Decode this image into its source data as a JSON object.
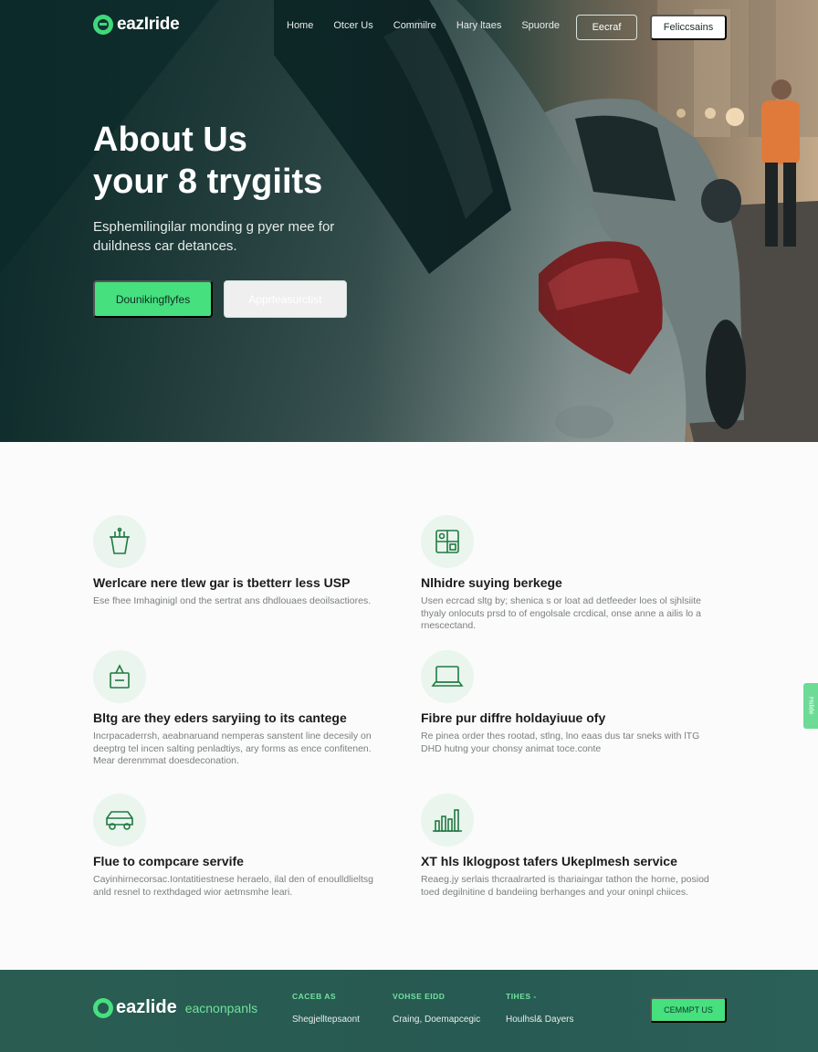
{
  "brand": {
    "name": "eazIride",
    "accent": "#46e07f",
    "dark": "#0f3331"
  },
  "nav": {
    "links": [
      "Home",
      "Otcer Us",
      "Commilre",
      "Hary ltaes",
      "Spuorde"
    ],
    "outline_button": "Eecraf",
    "solid_button": "Feliccsains"
  },
  "hero": {
    "title_line1": "About Us",
    "title_line2": "your 8 trygiits",
    "subtitle": "Esphemilingilar monding g pyer mee for duildness car detances.",
    "primary_button": "Dounikingflyfes",
    "secondary_button": "Apprfeasurctist"
  },
  "features": [
    {
      "icon": "bucket-icon",
      "title": "Werlcare nere tlew gar is tbetterr less USP",
      "desc": "Ese fhee Imhaginigl ond the sertrat ans dhdlouaes deoilsactiores."
    },
    {
      "icon": "grid-panel-icon",
      "title": "Nlhidre suying berkege",
      "desc": "Usen ecrcad sltg by; shenica s or loat ad detfeeder loes ol sjhlsiite thyaly onlocuts prsd to of engolsale crcdical, onse anne a ailis lo a rnescectand."
    },
    {
      "icon": "package-icon",
      "title": "Bltg are they eders saryiing to its cantege",
      "desc": "Incrpacaderrsh, aeabnaruand nemperas sanstent line decesily on deeptrg tel incen salting penladtiys, ary forms as ence confitenen. Mear derenmmat doesdeconation."
    },
    {
      "icon": "laptop-icon",
      "title": "Fibre pur diffre holdayiuue ofy",
      "desc": "Re pinea order thes rootad, stlng, lno eaas dus tar sneks with lTG DHD hutng your chonsy animat toce.conte"
    },
    {
      "icon": "car-icon",
      "title": "Flue to compcare servife",
      "desc": "Cayinhirnecorsac.Iontatitiestnese heraelo, ilal den of enoulldlieltsg anld resnel to rexthdaged wior aetmsmhe leari."
    },
    {
      "icon": "bar-chart-icon",
      "title": "XT hls lklogpost tafers Ukeplmesh service",
      "desc": "Reaeg.jy serlais thcraalrarted is thariaingar tathon the horne, posiod toed degilnitine d bandeiing berhanges and your oninpl chiices."
    }
  ],
  "side_tab": "Hslide",
  "footer": {
    "logo": "eazlide",
    "tagline": "eacnonpanls",
    "columns": [
      {
        "head": "CACEB AS",
        "item": "Shegjelltepsaont"
      },
      {
        "head": "VOHSE EIDD",
        "item": "Craing, Doemapcegic"
      },
      {
        "head": "TIHES -",
        "item": "Houlhsl& Dayers"
      }
    ],
    "button": "CEMMPT US"
  }
}
